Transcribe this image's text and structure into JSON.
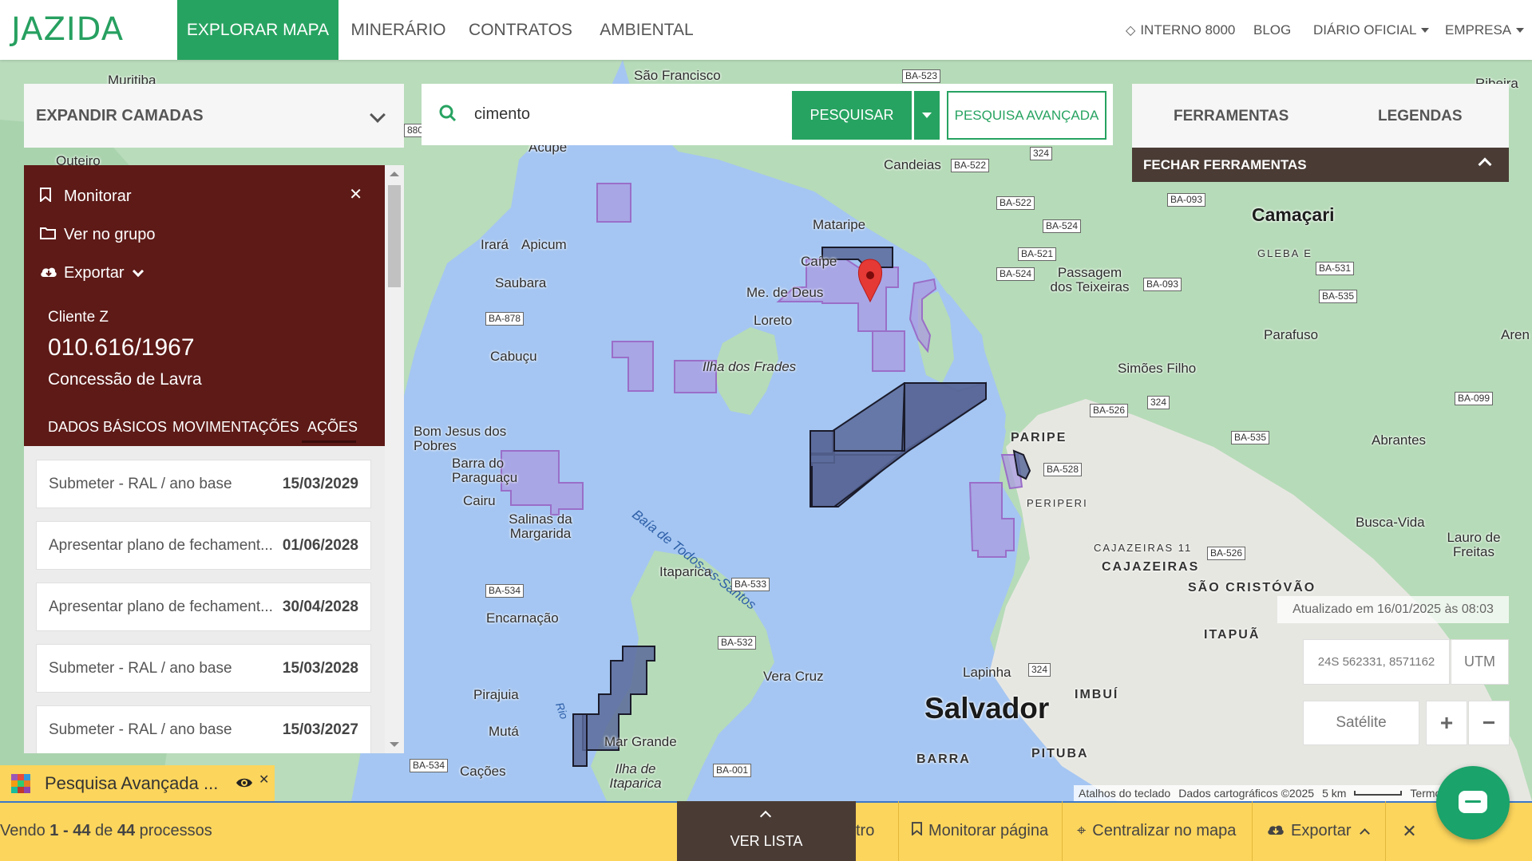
{
  "brand": {
    "logo": "JAZIDA",
    "accent": "#27a361"
  },
  "nav": {
    "tabs": [
      "EXPLORAR MAPA",
      "MINERÁRIO",
      "CONTRATOS",
      "AMBIENTAL"
    ],
    "right": {
      "internal": "INTERNO 8000",
      "blog": "BLOG",
      "diario": "DIÁRIO OFICIAL",
      "empresa": "EMPRESA"
    }
  },
  "layers": {
    "label": "EXPANDIR CAMADAS"
  },
  "search": {
    "value": "cimento",
    "button": "PESQUISAR",
    "advanced": "PESQUISA AVANÇADA"
  },
  "tools": {
    "ferramentas": "FERRAMENTAS",
    "legendas": "LEGENDAS",
    "close": "FECHAR FERRAMENTAS"
  },
  "detail": {
    "actions": {
      "monitor": "Monitorar",
      "group": "Ver no grupo",
      "export": "Exportar"
    },
    "client": "Cliente Z",
    "process": "010.616/1967",
    "type": "Concessão de Lavra",
    "tabs": [
      "DADOS BÁSICOS",
      "MOVIMENTAÇÕES",
      "AÇÕES"
    ]
  },
  "events": [
    {
      "text": "Submeter - RAL / ano base",
      "date": "15/03/2029"
    },
    {
      "text": "Apresentar plano de fechament...",
      "date": "01/06/2028"
    },
    {
      "text": "Apresentar plano de fechament...",
      "date": "30/04/2028"
    },
    {
      "text": "Submeter - RAL / ano base",
      "date": "15/03/2028"
    },
    {
      "text": "Submeter - RAL / ano base",
      "date": "15/03/2027"
    }
  ],
  "map": {
    "updated": "Atualizado em 16/01/2025 às 08:03",
    "coords": "24S 562331, 8571162",
    "utm": "UTM",
    "satellite": "Satélite",
    "attribution": {
      "keyboard": "Atalhos do teclado",
      "data": "Dados cartográficos ©2025",
      "scale": "5 km",
      "terms": "Termos"
    },
    "places": {
      "salvador": "Salvador",
      "camacari": "Camaçari",
      "saofrancisco": "São Francisco",
      "candeias": "Candeias",
      "mataripe": "Mataripe",
      "caipe": "Caípe",
      "medeus": "Me. de Deus",
      "loreto": "Loreto",
      "frades": "Ilha dos Frades",
      "baia": "Baía de Todos-os-Santos",
      "irara": "Irará",
      "apicum": "Apicum",
      "saubara": "Saubara",
      "cabucu": "Cabuçu",
      "bomjesus": "Bom Jesus dos Pobres",
      "barra": "Barra do Paraguaçu",
      "cairu": "Cairu",
      "salinas": "Salinas da Margarida",
      "itaparica": "Itaparica",
      "encarnacao": "Encarnação",
      "pirajuia": "Pirajuia",
      "muta": "Mutá",
      "cacoes": "Cações",
      "margrande": "Mar Grande",
      "ilhaitaparica": "Ilha de Itaparica",
      "veracruz": "Vera Cruz",
      "lapinha": "Lapinha",
      "imbui": "IMBUÍ",
      "pituba": "PITUBA",
      "barrasalv": "BARRA",
      "itapua": "ITAPUÃ",
      "saocristovao": "SÃO CRISTÓVÃO",
      "cajazeiras": "CAJAZEIRAS",
      "cajazeiras11": "CAJAZEIRAS 11",
      "paripe": "PARIPE",
      "periperi": "PERIPERI",
      "simoesfilho": "Simões Filho",
      "passagem": "Passagem dos Teixeiras",
      "parafuso": "Parafuso",
      "abrantes": "Abrantes",
      "buscavida": "Busca-Vida",
      "lauro": "Lauro de Freitas",
      "gleba": "GLEBA E",
      "muritiba": "Muritiba",
      "outeiro": "Outeiro",
      "acupe": "Acupe",
      "rio": "Rio",
      "riba": "Ribeira",
      "areia": "Aren"
    },
    "roads": [
      "BA-523",
      "BA-522",
      "324",
      "BA-522",
      "BA-093",
      "BA-524",
      "BA-521",
      "BA-524",
      "BA-093",
      "BA-531",
      "BA-535",
      "BA-878",
      "BA-526",
      "324",
      "BA-099",
      "BA-535",
      "BA-528",
      "BA-526",
      "BA-534",
      "BA-533",
      "BA-532",
      "324",
      "BA-534",
      "BA-001",
      "880"
    ]
  },
  "savedSearch": {
    "label": "Pesquisa Avançada ..."
  },
  "bottom": {
    "count_pre": "Vendo",
    "range": "1 - 44",
    "of": "de",
    "total": "44",
    "suffix": "processos",
    "verlista": "VER LISTA",
    "filtro": "tro",
    "monitorar": "Monitorar página",
    "centralizar": "Centralizar no mapa",
    "exportar": "Exportar"
  }
}
